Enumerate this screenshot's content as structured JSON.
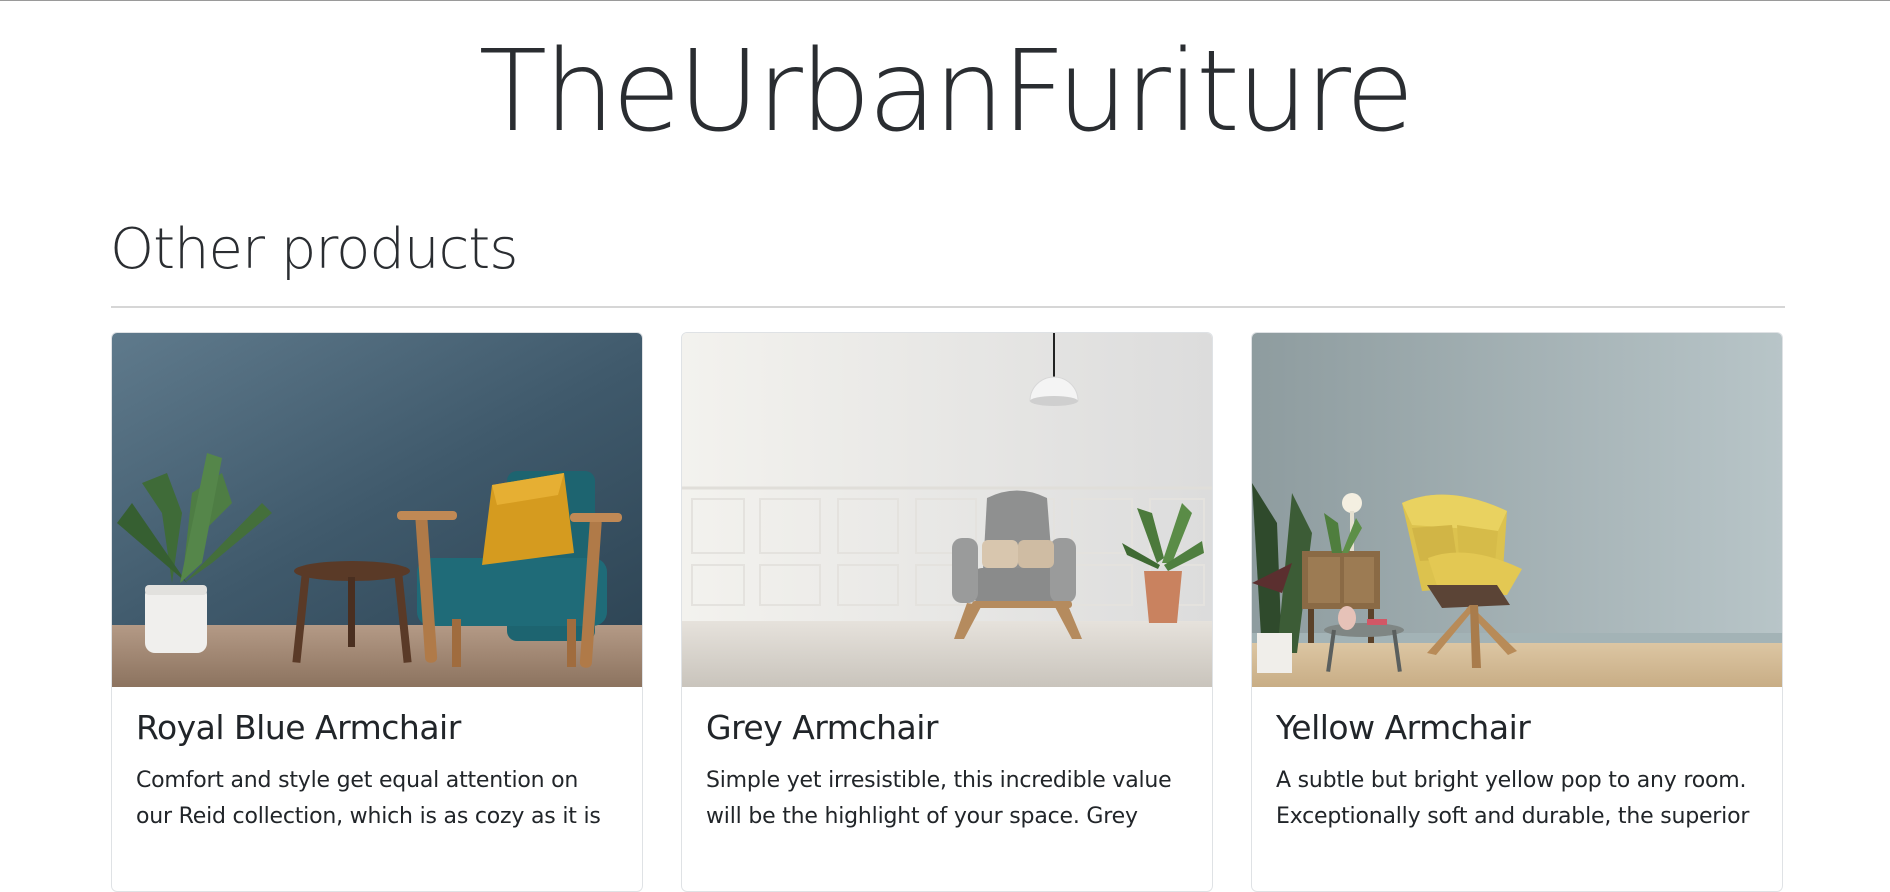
{
  "site": {
    "title": "TheUrbanFuriture"
  },
  "section": {
    "title": "Other products"
  },
  "products": [
    {
      "name": "Royal Blue Armchair",
      "description": "Comfort and style get equal attention on our Reid collection, which is as cozy as it is",
      "image_icon": "royal-blue-armchair-photo"
    },
    {
      "name": "Grey Armchair",
      "description": "Simple yet irresistible, this incredible value will be the highlight of your space. Grey",
      "image_icon": "grey-armchair-photo"
    },
    {
      "name": "Yellow Armchair",
      "description": "A subtle but bright yellow pop to any room. Exceptionally soft and durable, the superior",
      "image_icon": "yellow-armchair-photo"
    }
  ],
  "colors": {
    "text": "#212529",
    "divider": "#d6d6d6",
    "card_border": "#dfe2e5"
  }
}
